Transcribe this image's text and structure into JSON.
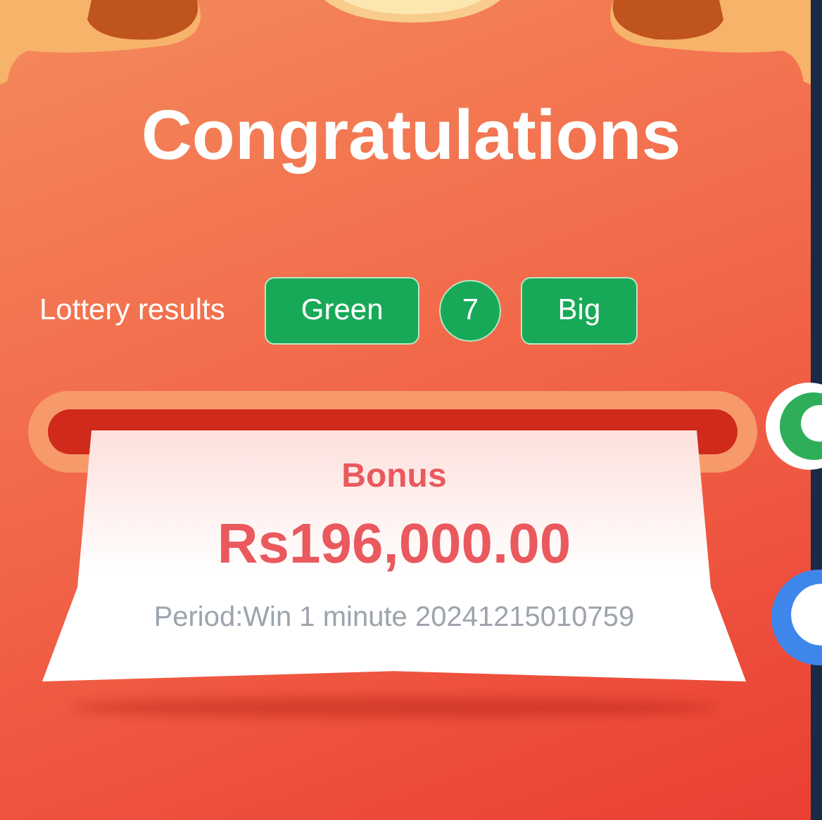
{
  "title": "Congratulations",
  "lottery": {
    "label": "Lottery results",
    "results": [
      {
        "label": "Green",
        "kind": "pill"
      },
      {
        "label": "7",
        "kind": "circle"
      },
      {
        "label": "Big",
        "kind": "pill"
      }
    ]
  },
  "bonus": {
    "label": "Bonus",
    "amount": "Rs196,000.00",
    "period": "Period:Win 1 minute 20241215010759"
  }
}
